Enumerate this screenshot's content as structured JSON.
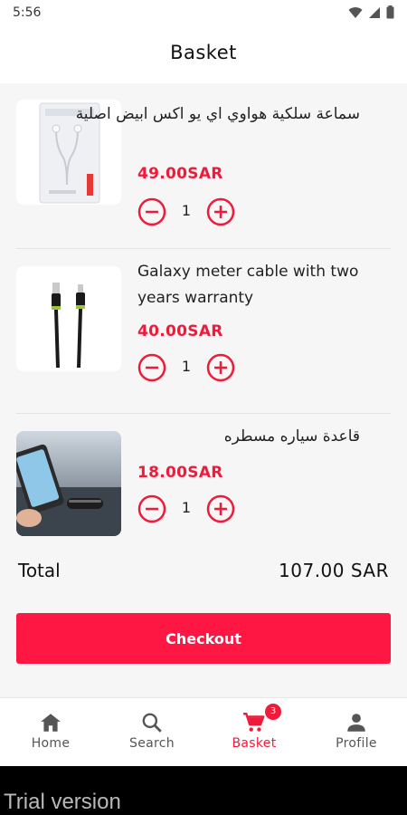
{
  "status_bar": {
    "time": "5:56"
  },
  "header": {
    "title": "Basket"
  },
  "items": [
    {
      "name": "سماعة سلكية هواوي اي يو اكس ابيض اصلية",
      "price": "49.00SAR",
      "quantity": "1",
      "rtl": true,
      "thumb": "earphones-box"
    },
    {
      "name": "Galaxy meter cable with two years warranty",
      "price": "40.00SAR",
      "quantity": "1",
      "rtl": false,
      "thumb": "usb-cable"
    },
    {
      "name": "قاعدة سياره مسطره",
      "price": "18.00SAR",
      "quantity": "1",
      "rtl": true,
      "thumb": "car-holder"
    }
  ],
  "total": {
    "label": "Total",
    "value": "107.00 SAR"
  },
  "checkout": {
    "label": "Checkout"
  },
  "nav": {
    "items": [
      {
        "label": "Home",
        "icon": "home-icon"
      },
      {
        "label": "Search",
        "icon": "search-icon"
      },
      {
        "label": "Basket",
        "icon": "cart-icon",
        "badge": "3",
        "active": true
      },
      {
        "label": "Profile",
        "icon": "person-icon"
      }
    ]
  },
  "watermark": {
    "text": "Trial version"
  },
  "colors": {
    "accent": "#ee1b3b",
    "button": "#ff1744",
    "background": "#f6f6f6"
  }
}
